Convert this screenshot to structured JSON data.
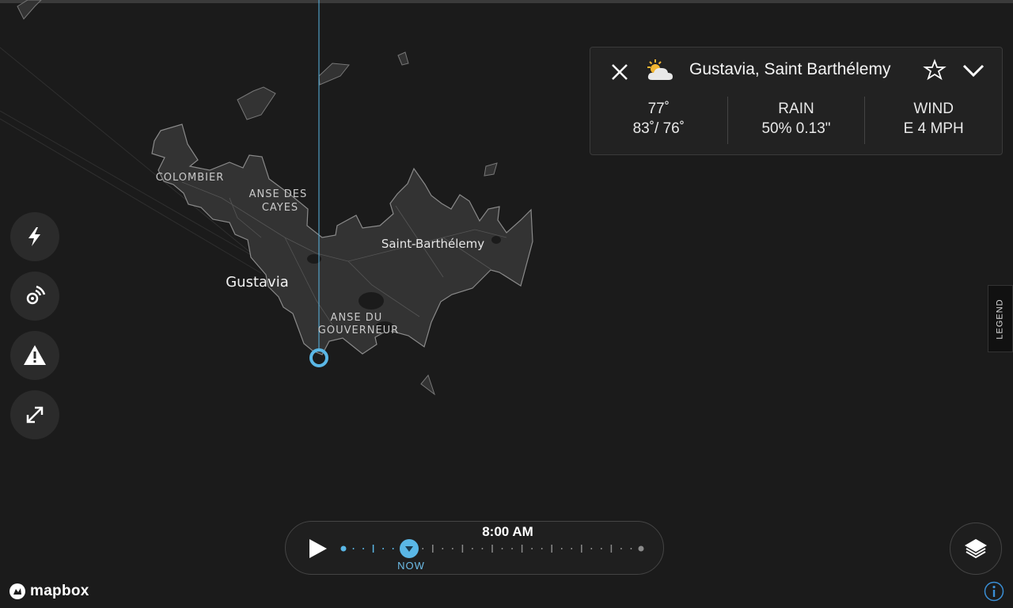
{
  "map": {
    "places": [
      {
        "name": "colombier",
        "lines": [
          "COLOMBIER"
        ]
      },
      {
        "name": "anse-des-cayes",
        "lines": [
          "ANSE DES",
          "CAYES"
        ]
      },
      {
        "name": "saint-barthelemy",
        "lines": [
          "Saint-Barthélemy"
        ]
      },
      {
        "name": "gustavia",
        "lines": [
          "Gustavia"
        ]
      },
      {
        "name": "anse-du-gouverneur",
        "lines": [
          "ANSE DU",
          "GOUVERNEUR"
        ]
      }
    ],
    "marker_color": "#5ab7e6",
    "land_color": "#333333"
  },
  "sidebar": {
    "buttons": [
      {
        "name": "lightning-button",
        "icon": "lightning-bolt-icon"
      },
      {
        "name": "radar-button",
        "icon": "radar-signal-icon"
      },
      {
        "name": "alerts-button",
        "icon": "warning-triangle-icon"
      },
      {
        "name": "expand-button",
        "icon": "expand-arrows-icon"
      }
    ]
  },
  "panel": {
    "title": "Gustavia, Saint Barthélemy",
    "weather_icon": "partly-cloudy-icon",
    "temperature": "77˚",
    "high_low": "83˚/ 76˚",
    "rain_label": "RAIN",
    "rain_value": "50% 0.13\"",
    "wind_label": "WIND",
    "wind_value": "E 4 MPH"
  },
  "legend": {
    "label": "LEGEND"
  },
  "timeline": {
    "time": "8:00 AM",
    "now_label": "NOW",
    "accent": "#5ab7e6"
  },
  "attribution": {
    "logo_text": "mapbox"
  }
}
